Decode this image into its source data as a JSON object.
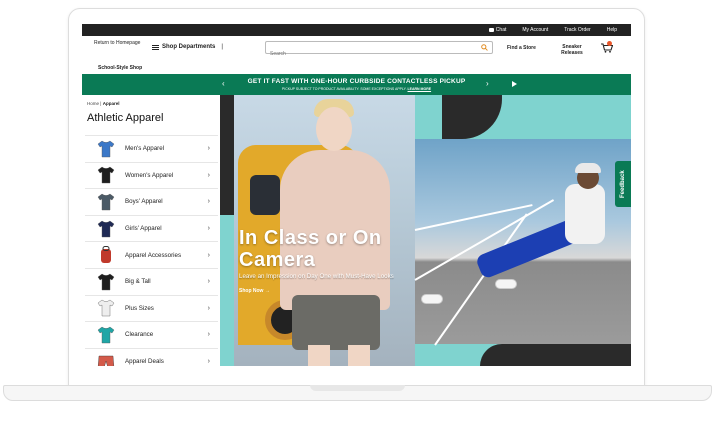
{
  "utility_bar": {
    "chat": "Chat",
    "my_account": "My Account",
    "track_order": "Track Order",
    "help": "Help"
  },
  "header": {
    "return_link": "Return to Homepage",
    "shop_departments": "Shop Departments",
    "separator": "|",
    "search_placeholder": "Search",
    "find_store": "Find a Store",
    "sneaker_releases": "Sneaker Releases",
    "school_style": "School-Style Shop"
  },
  "promo": {
    "title": "GET IT FAST WITH ONE-HOUR CURBSIDE CONTACTLESS PICKUP",
    "subtitle": "PICKUP SUBJECT TO PRODUCT AVAILABILITY. SOME EXCEPTIONS APPLY.",
    "learn_more": "LEARN MORE",
    "prev": "‹",
    "next": "›"
  },
  "sidebar": {
    "breadcrumb_home": "Home",
    "breadcrumb_sep": "|",
    "breadcrumb_current": "Apparel",
    "title": "Athletic Apparel",
    "items": [
      {
        "label": "Men's Apparel",
        "icon": "shirt-blue-icon"
      },
      {
        "label": "Women's Apparel",
        "icon": "shirt-black-icon"
      },
      {
        "label": "Boys' Apparel",
        "icon": "shirt-gray-icon"
      },
      {
        "label": "Girls' Apparel",
        "icon": "shirt-navy-icon"
      },
      {
        "label": "Apparel Accessories",
        "icon": "backpack-icon"
      },
      {
        "label": "Big & Tall",
        "icon": "shirt-black-icon"
      },
      {
        "label": "Plus Sizes",
        "icon": "shirt-white-icon"
      },
      {
        "label": "Clearance",
        "icon": "shirt-teal-icon"
      },
      {
        "label": "Apparel Deals",
        "icon": "shorts-icon"
      }
    ]
  },
  "hero": {
    "title_line1": "In Class or On",
    "title_line2": "Camera",
    "subtitle": "Leave an Impression on Day One with Must-Have Looks",
    "cta": "Shop Now",
    "cta_arrow": "→"
  },
  "feedback": "Feedback",
  "colors": {
    "brand_green": "#0a7a55",
    "accent_teal": "#7fd3cf",
    "cart_badge": "#e8562a"
  }
}
